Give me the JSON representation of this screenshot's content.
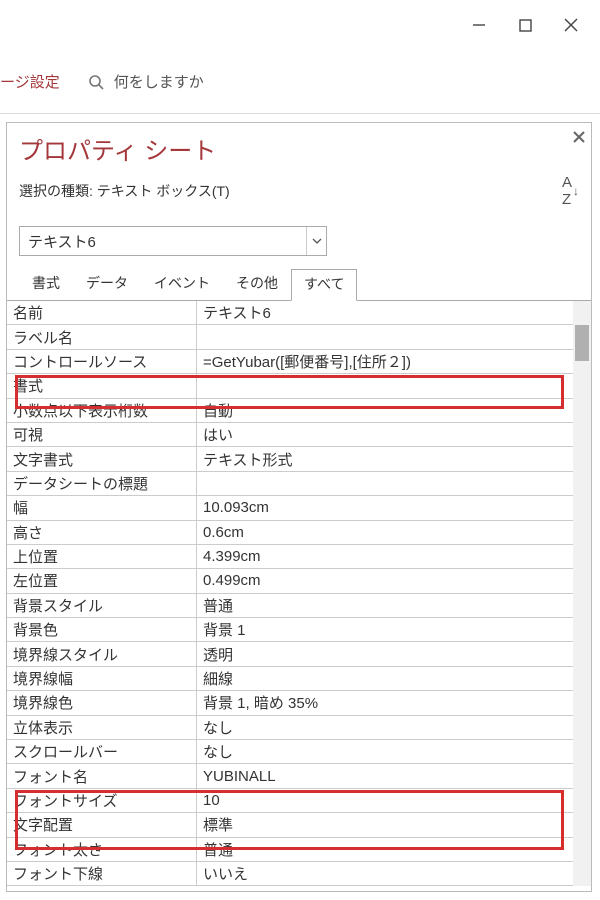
{
  "titlebar": {},
  "ribbon": {
    "tab_settings": "ージ設定",
    "search_placeholder": "何をしますか"
  },
  "pane": {
    "title": "プロパティ シート",
    "selection_type_label": "選択の種類: テキスト ボックス(T)",
    "sort_label": "A↓",
    "dropdown_value": "テキスト6",
    "tabs": {
      "format": "書式",
      "data": "データ",
      "event": "イベント",
      "other": "その他",
      "all": "すべて"
    },
    "rows": [
      {
        "label": "名前",
        "value": "テキスト6"
      },
      {
        "label": "ラベル名",
        "value": ""
      },
      {
        "label": "コントロールソース",
        "value": "=GetYubar([郵便番号],[住所２])"
      },
      {
        "label": "書式",
        "value": ""
      },
      {
        "label": "小数点以下表示桁数",
        "value": "自動"
      },
      {
        "label": "可視",
        "value": "はい"
      },
      {
        "label": "文字書式",
        "value": "テキスト形式"
      },
      {
        "label": "データシートの標題",
        "value": ""
      },
      {
        "label": "幅",
        "value": "10.093cm"
      },
      {
        "label": "高さ",
        "value": "0.6cm"
      },
      {
        "label": "上位置",
        "value": "4.399cm"
      },
      {
        "label": "左位置",
        "value": "0.499cm"
      },
      {
        "label": "背景スタイル",
        "value": "普通"
      },
      {
        "label": "背景色",
        "value": "背景 1"
      },
      {
        "label": "境界線スタイル",
        "value": "透明"
      },
      {
        "label": "境界線幅",
        "value": "細線"
      },
      {
        "label": "境界線色",
        "value": "背景 1, 暗め 35%"
      },
      {
        "label": "立体表示",
        "value": "なし"
      },
      {
        "label": "スクロールバー",
        "value": "なし"
      },
      {
        "label": "フォント名",
        "value": "YUBINALL"
      },
      {
        "label": "フォントサイズ",
        "value": "10"
      },
      {
        "label": "文字配置",
        "value": "標準"
      },
      {
        "label": "フォント太さ",
        "value": "普通"
      },
      {
        "label": "フォント下線",
        "value": "いいえ"
      }
    ]
  }
}
